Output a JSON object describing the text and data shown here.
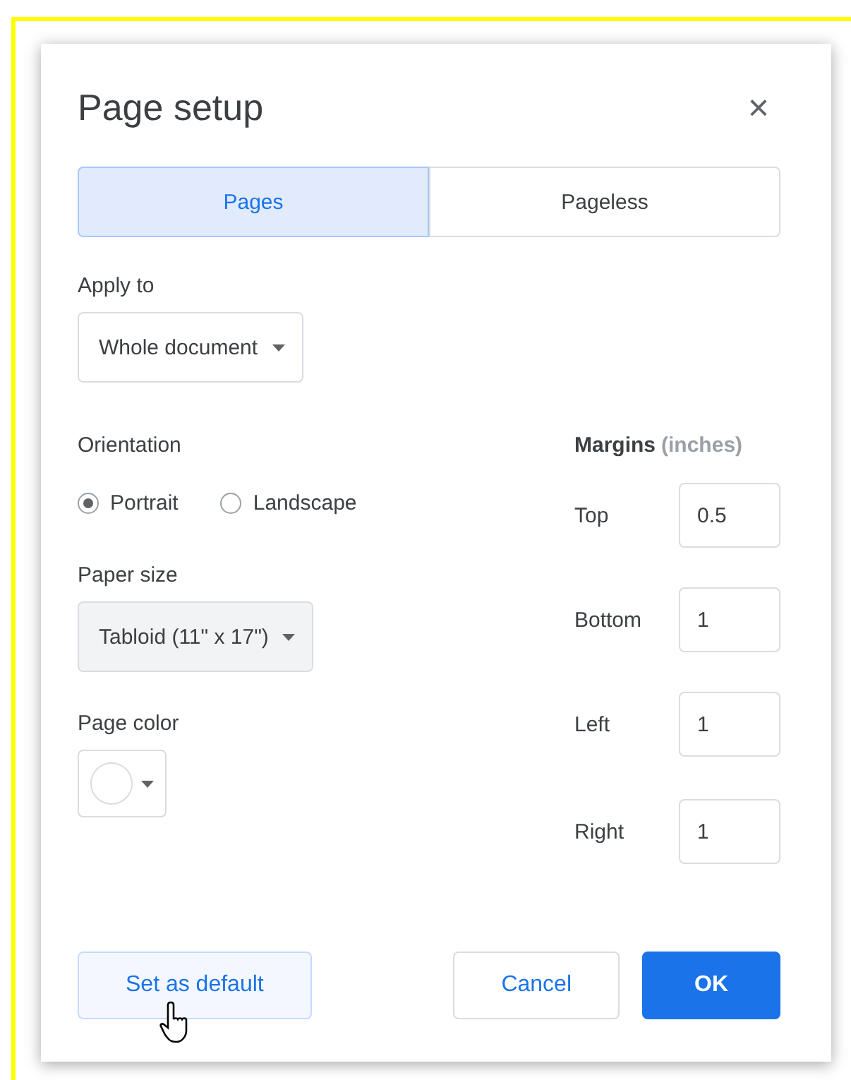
{
  "dialog": {
    "title": "Page setup",
    "close": "×"
  },
  "tabs": [
    {
      "label": "Pages",
      "selected": true
    },
    {
      "label": "Pageless",
      "selected": false
    }
  ],
  "apply_to": {
    "label": "Apply to",
    "value": "Whole document"
  },
  "orientation": {
    "label": "Orientation",
    "options": [
      {
        "label": "Portrait",
        "selected": true
      },
      {
        "label": "Landscape",
        "selected": false
      }
    ]
  },
  "paper_size": {
    "label": "Paper size",
    "value": "Tabloid (11\" x 17\")"
  },
  "page_color": {
    "label": "Page color",
    "color": "#ffffff"
  },
  "margins": {
    "label": "Margins",
    "unit": "(inches)",
    "fields": [
      {
        "label": "Top",
        "value": "0.5"
      },
      {
        "label": "Bottom",
        "value": "1"
      },
      {
        "label": "Left",
        "value": "1"
      },
      {
        "label": "Right",
        "value": "1"
      }
    ]
  },
  "buttons": [
    {
      "label": "Set as default",
      "kind": "secondary",
      "hovered": true
    },
    {
      "label": "Cancel",
      "kind": "outline",
      "hovered": false
    },
    {
      "label": "OK",
      "kind": "primary",
      "hovered": false
    }
  ]
}
